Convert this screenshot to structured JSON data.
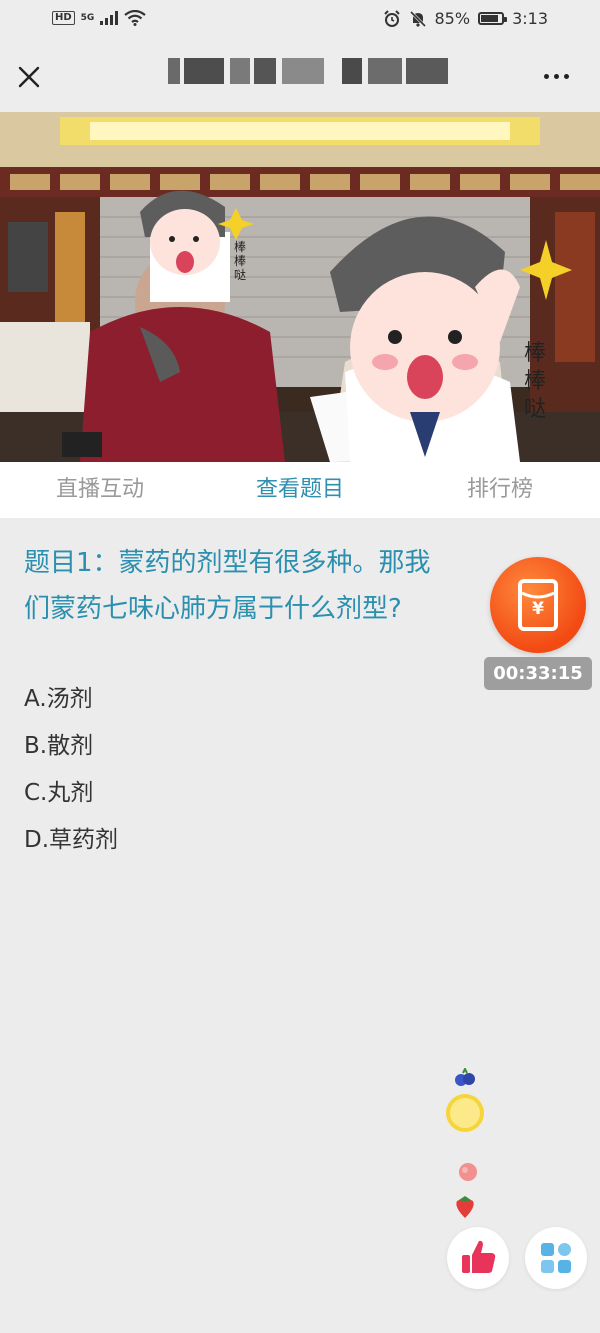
{
  "status_bar": {
    "hd": "HD",
    "network": "5G",
    "battery": "85%",
    "battery_level": 0.85,
    "time": "3:13"
  },
  "nav": {
    "title": "▒▒▒▒▒ ▒▒▒▒▒"
  },
  "video": {
    "sticker_text": "棒棒哒"
  },
  "tabs": [
    {
      "label": "直播互动"
    },
    {
      "label": "查看题目"
    },
    {
      "label": "排行榜"
    }
  ],
  "question": {
    "text": "题目1：蒙药的剂型有很多种。那我们蒙药七味心肺方属于什么剂型?",
    "options": [
      {
        "label": "A.汤剂"
      },
      {
        "label": "B.散剂"
      },
      {
        "label": "C.丸剂"
      },
      {
        "label": "D.草药剂"
      }
    ]
  },
  "reward": {
    "icon": "red-envelope-yen-icon",
    "symbol": "¥",
    "timer": "00:33:15"
  },
  "colors": {
    "accent": "#2f8fae",
    "reward": "#f24a13",
    "like": "#e8335a",
    "grid": "#57b3e6"
  }
}
